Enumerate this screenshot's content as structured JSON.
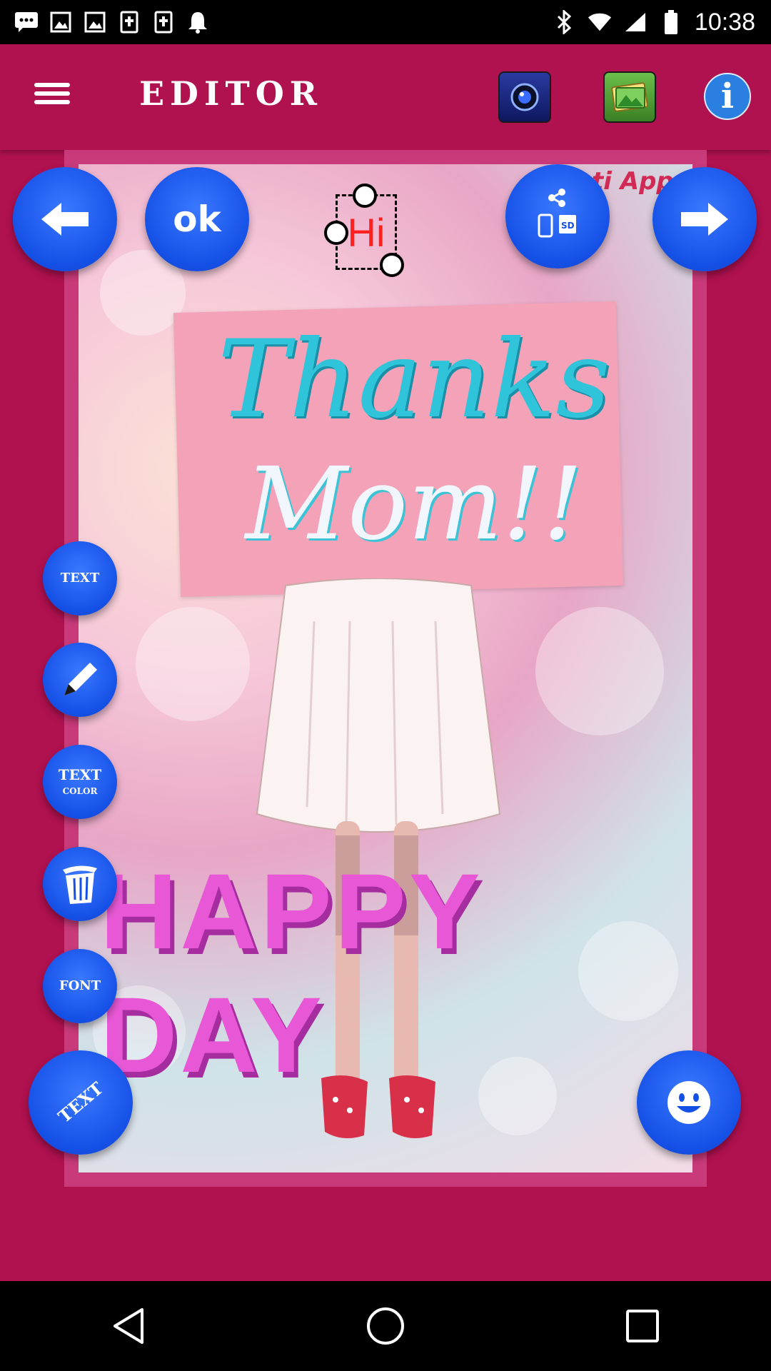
{
  "status_bar": {
    "time": "10:38",
    "icons": [
      "message-icon",
      "image-icon",
      "image-icon",
      "document-icon",
      "document-icon",
      "notification-icon",
      "bluetooth-icon",
      "wifi-icon",
      "signal-icon",
      "battery-icon"
    ]
  },
  "app_bar": {
    "title": "EDITOR",
    "info_label": "i"
  },
  "card": {
    "brand_text": "Janti Apps",
    "sign_line1": "Thanks",
    "sign_line2": "Mom!!",
    "banner_text": "HAPPY DAY"
  },
  "sticker": {
    "text": "Hi"
  },
  "buttons": {
    "ok": "ok",
    "text": "TEXT",
    "text_color_line1": "TEXT",
    "text_color_line2": "COLOR",
    "font": "FONT",
    "text_3d": "TEXT"
  },
  "colors": {
    "background": "#b0114f",
    "button_blue": "#1550e6",
    "banner_pink": "#e858d6",
    "sign_teal": "#2fc4d9"
  }
}
